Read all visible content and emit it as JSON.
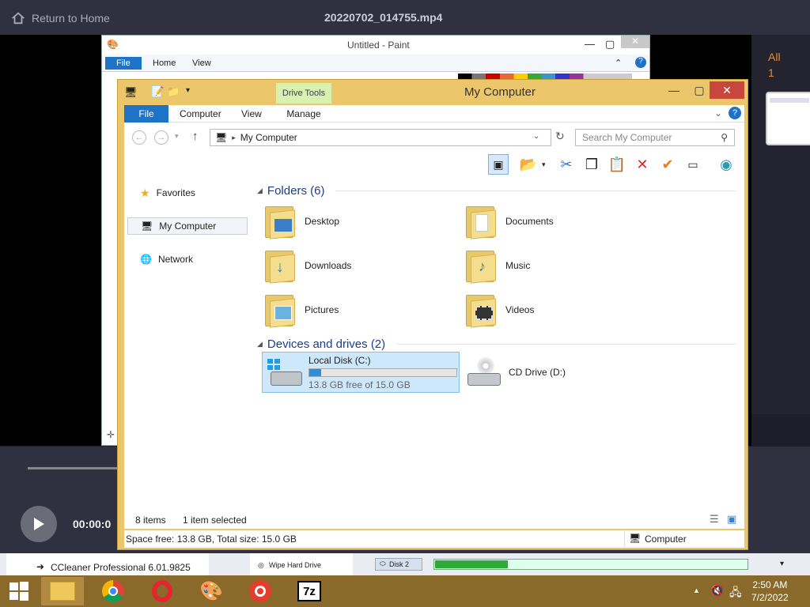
{
  "player": {
    "home_label": "Return to Home",
    "video_title": "20220702_014755.mp4",
    "all_label": "All",
    "all_count": "1",
    "time": "00:00:0"
  },
  "paint": {
    "title": "Untitled - Paint",
    "tabs": [
      "File",
      "Home",
      "View"
    ]
  },
  "explorer": {
    "title": "My Computer",
    "context_tab": "Drive Tools",
    "tabs": {
      "file": "File",
      "computer": "Computer",
      "view": "View",
      "manage": "Manage"
    },
    "address": "My Computer",
    "search_placeholder": "Search My Computer",
    "nav": {
      "favorites": "Favorites",
      "my_computer": "My Computer",
      "network": "Network"
    },
    "folders_header": "Folders (6)",
    "folders": [
      "Desktop",
      "Documents",
      "Downloads",
      "Music",
      "Pictures",
      "Videos"
    ],
    "devices_header": "Devices and drives (2)",
    "drive_c": {
      "name": "Local Disk (C:)",
      "free": "13.8 GB free of 15.0 GB",
      "used_fraction": 0.08
    },
    "drive_d": {
      "name": "CD Drive (D:)"
    },
    "status": {
      "items": "8 items",
      "selected": "1 item selected"
    },
    "footer": {
      "space": "Space free: 13.8 GB, Total size: 15.0 GB",
      "location": "Computer"
    }
  },
  "background": {
    "ccleaner": "CCleaner Professional 6.01.9825",
    "wipe": "Wipe Hard Drive",
    "disk": "Disk 2"
  },
  "taskbar": {
    "time": "2:50 AM",
    "date": "7/2/2022",
    "apps": [
      "file-explorer-icon",
      "chrome-icon",
      "opera-icon",
      "paint-icon",
      "recorder-icon",
      "7zip-icon"
    ],
    "sevenzip_label": "7z"
  },
  "colors": {
    "accent": "#1f73c7",
    "window_frame": "#ecc66a",
    "taskbar": "#8a6a2a",
    "close": "#c9463d"
  }
}
